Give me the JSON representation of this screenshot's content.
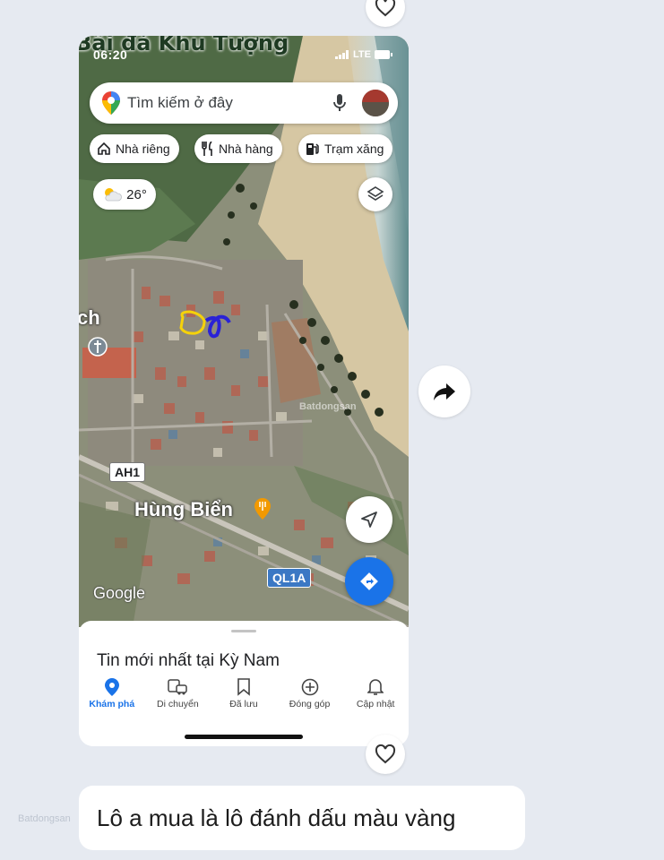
{
  "chat": {
    "message_text": "Lô a mua là lô đánh dấu màu vàng",
    "watermark": "Batdongsan"
  },
  "phone": {
    "status_time": "06:20",
    "status_network": "LTE",
    "map_top_label": "Bãi đá Khu Tượng",
    "search": {
      "placeholder": "Tìm kiếm ở đây"
    },
    "chips": [
      {
        "label": "Nhà riêng",
        "icon": "home-icon"
      },
      {
        "label": "Nhà hàng",
        "icon": "restaurant-icon"
      },
      {
        "label": "Trạm xăng",
        "icon": "gas-station-icon"
      }
    ],
    "weather": {
      "temp": "26°",
      "icon": "partly-cloudy-icon"
    },
    "map_labels": {
      "left_partial": "ch",
      "place": "Hùng Biển",
      "road_ah1": "AH1",
      "road_ql1a": "QL1A",
      "google": "Google",
      "map_watermark": "Batdongsan"
    },
    "bottom_sheet": {
      "title": "Tin mới nhất tại Kỳ Nam"
    },
    "nav": [
      {
        "label": "Khám phá",
        "icon": "location-pin-icon",
        "active": true
      },
      {
        "label": "Di chuyển",
        "icon": "commute-icon",
        "active": false
      },
      {
        "label": "Đã lưu",
        "icon": "bookmark-icon",
        "active": false
      },
      {
        "label": "Đóng góp",
        "icon": "add-circle-icon",
        "active": false
      },
      {
        "label": "Cập nhật",
        "icon": "bell-icon",
        "active": false
      }
    ],
    "colors": {
      "google_blue": "#1a73e8",
      "marker_yellow": "#f5d20a",
      "marker_blue": "#2a22d6"
    }
  }
}
